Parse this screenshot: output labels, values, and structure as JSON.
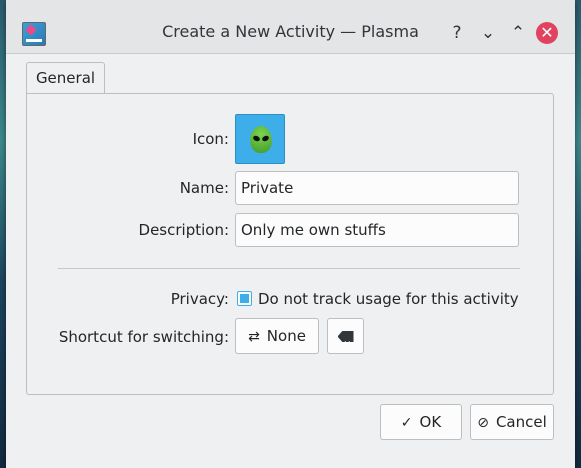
{
  "window": {
    "title": "Create a New Activity — Plasma",
    "controls": {
      "help": "?",
      "minimize": "⌄",
      "maximize": "⌃",
      "close": "✕"
    }
  },
  "tabs": [
    {
      "label": "General",
      "active": true
    }
  ],
  "form": {
    "icon_label": "Icon:",
    "icon_name": "alien-icon",
    "name_label": "Name:",
    "name_value": "Private",
    "description_label": "Description:",
    "description_value": "Only me own stuffs",
    "privacy_label": "Privacy:",
    "privacy_checkbox_label": "Do not track usage for this activity",
    "privacy_checked": true,
    "shortcut_label": "Shortcut for switching:",
    "shortcut_value": "None"
  },
  "buttons": {
    "ok": "OK",
    "cancel": "Cancel"
  },
  "colors": {
    "accent": "#3daee9",
    "close": "#e0425f"
  }
}
